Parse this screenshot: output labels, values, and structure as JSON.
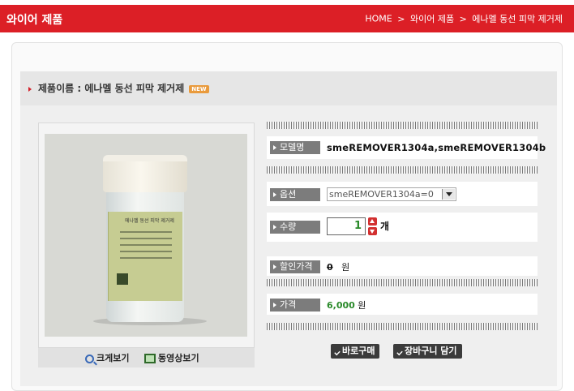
{
  "header": {
    "title": "와이어 제품",
    "breadcrumb": [
      "HOME",
      "와이어 제품",
      "에나멜 동선 피막 제거제"
    ],
    "separator": ">"
  },
  "product": {
    "name_label": "제품이름 : 에나멜 동선 피막 제거제",
    "badge": "NEW",
    "label_text": "에나멜 동선 피막 제거제"
  },
  "view": {
    "zoom_label": "크게보기",
    "video_label": "동영상보기"
  },
  "fields": {
    "model_label": "모델명",
    "model_value": "smeREMOVER1304a,smeREMOVER1304b",
    "option_label": "옵션",
    "option_value": "smeREMOVER1304a=0",
    "qty_label": "수량",
    "qty_value": "1",
    "qty_unit": "개",
    "discount_label": "할인가격",
    "discount_value": "0",
    "discount_unit": "원",
    "price_label": "가격",
    "price_value": "6,000",
    "price_unit": "원"
  },
  "actions": {
    "buy_now": "바로구매",
    "add_cart": "장바구니 담기"
  },
  "colors": {
    "brand_red": "#dc1f26",
    "price_green": "#2a8a2a",
    "new_badge": "#e99a3c"
  }
}
